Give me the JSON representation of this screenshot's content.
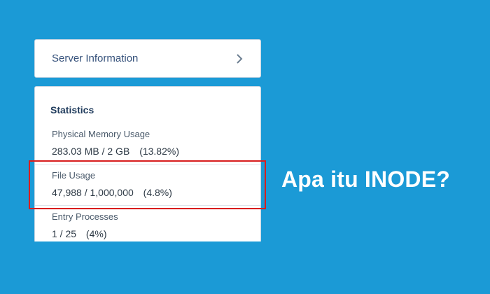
{
  "server_panel": {
    "label": "Server Information"
  },
  "statistics": {
    "title": "Statistics",
    "items": [
      {
        "label": "Physical Memory Usage",
        "value": "283.03 MB / 2 GB",
        "percent": "(13.82%)"
      },
      {
        "label": "File Usage",
        "value": "47,988 / 1,000,000",
        "percent": "(4.8%)"
      },
      {
        "label": "Entry Processes",
        "value": "1 / 25",
        "percent": "(4%)"
      }
    ]
  },
  "headline": "Apa itu INODE?",
  "colors": {
    "background": "#1b9ad6",
    "highlight": "#d81e1e",
    "panel": "#ffffff"
  }
}
